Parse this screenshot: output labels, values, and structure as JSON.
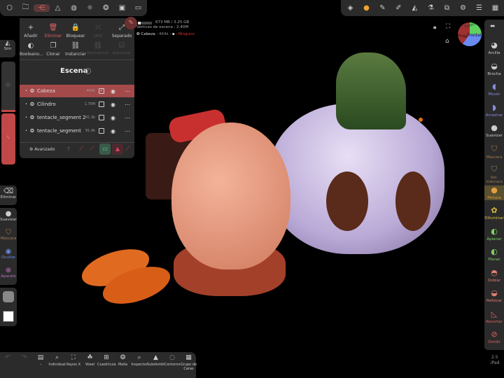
{
  "top_left_toolbar": {
    "icons": [
      "cube-icon",
      "folder-icon",
      "scene-tree-icon",
      "topology-icon",
      "sphere-icon",
      "sun-icon",
      "material-icon",
      "image-icon",
      "camera-icon"
    ],
    "active": 2
  },
  "top_right_toolbar": {
    "icons": [
      "interface-icon",
      "paint-sphere-icon",
      "pen-icon",
      "stroke-icon",
      "symmetry-icon",
      "flask-icon",
      "layers-icon",
      "settings-icon",
      "sliders-icon",
      "film-icon"
    ]
  },
  "panel": {
    "actions": [
      {
        "label": "Añadir",
        "icon": "+"
      },
      {
        "label": "Eliminar",
        "icon": "🗑"
      },
      {
        "label": "Bloquear",
        "icon": "🔒"
      },
      {
        "label": "Unir",
        "icon": "⤫"
      },
      {
        "label": "Separado",
        "icon": "⤢"
      },
      {
        "label": "Booleano...",
        "icon": "◐"
      },
      {
        "label": "Clonar",
        "icon": "❐"
      },
      {
        "label": "Instanciar",
        "icon": "⛓"
      },
      {
        "label": "Desinstanciar",
        "icon": "⛓"
      },
      {
        "label": "Seleccionar",
        "icon": "☑"
      }
    ],
    "title": "Escena",
    "rows": [
      {
        "name": "Cabeza",
        "size": "464k",
        "checked": true,
        "selected": true
      },
      {
        "name": "Cilindro",
        "size": "1.75M",
        "checked": false
      },
      {
        "name": "tentacle_segment 2",
        "size": "91.3k",
        "checked": false
      },
      {
        "name": "tentacle_segment",
        "size": "91.4k",
        "checked": false
      }
    ],
    "advanced": "Avanzado"
  },
  "info": {
    "memory": "673 MB / 3.25 GB",
    "vertices": "Vértices de escena : 2.40M",
    "object": "Cabeza",
    "object_size": "464k",
    "material": "Ninguno",
    "memory_fraction": 0.2
  },
  "left": {
    "sim": "Sim",
    "tools": [
      {
        "label": "Eliminar",
        "color": "#ccc"
      },
      {
        "label": "Suavizar",
        "color": "#ccc"
      },
      {
        "label": "Máscara",
        "color": "#a07a50"
      },
      {
        "label": "Ocultar",
        "color": "#6a8ae0"
      },
      {
        "label": "Aparato",
        "color": "#c070c0"
      }
    ]
  },
  "right_tools": [
    {
      "label": "Arcilla",
      "color": "#ccc"
    },
    {
      "label": "Brocha",
      "color": "#ccc"
    },
    {
      "label": "Mover",
      "color": "#8a8ae0"
    },
    {
      "label": "Arrastrar",
      "color": "#8a8ae0"
    },
    {
      "label": "Suavizar",
      "color": "#ccc"
    },
    {
      "label": "Máscara",
      "color": "#a07a50"
    },
    {
      "label": "Sel. máscara",
      "color": "#a07a50"
    },
    {
      "label": "Pintura",
      "color": "#e0a040"
    },
    {
      "label": "Difuminar",
      "color": "#e0c040"
    },
    {
      "label": "Aplanar",
      "color": "#80d060"
    },
    {
      "label": "Planar",
      "color": "#80d060"
    },
    {
      "label": "Doblar",
      "color": "#e08070"
    },
    {
      "label": "Pellizcar",
      "color": "#e08070"
    },
    {
      "label": "Recortar",
      "color": "#e06060"
    },
    {
      "label": "Dividir",
      "color": "#e06060"
    }
  ],
  "bottom": [
    {
      "label": "↶",
      "icon": "↶"
    },
    {
      "label": "↷",
      "icon": "↷"
    },
    {
      "label": "–",
      "icon": "▤"
    },
    {
      "label": "Individual",
      "icon": "⌕"
    },
    {
      "label": "Rayos X",
      "icon": "⛶"
    },
    {
      "label": "Vóxel",
      "icon": "☘"
    },
    {
      "label": "Cuadrícula",
      "icon": "⊞"
    },
    {
      "label": "Malla",
      "icon": "❂"
    },
    {
      "label": "Inspector",
      "icon": "⌕"
    },
    {
      "label": "Subdividir",
      "icon": "▲"
    },
    {
      "label": "Contorno",
      "icon": "◌"
    },
    {
      "label": "Grupo de Caras",
      "icon": "▦"
    }
  ],
  "gizmo": {
    "front": "Frontal",
    "side": "Izquierda",
    "top": "Superior"
  },
  "version": "2.5",
  "device": "iPad"
}
